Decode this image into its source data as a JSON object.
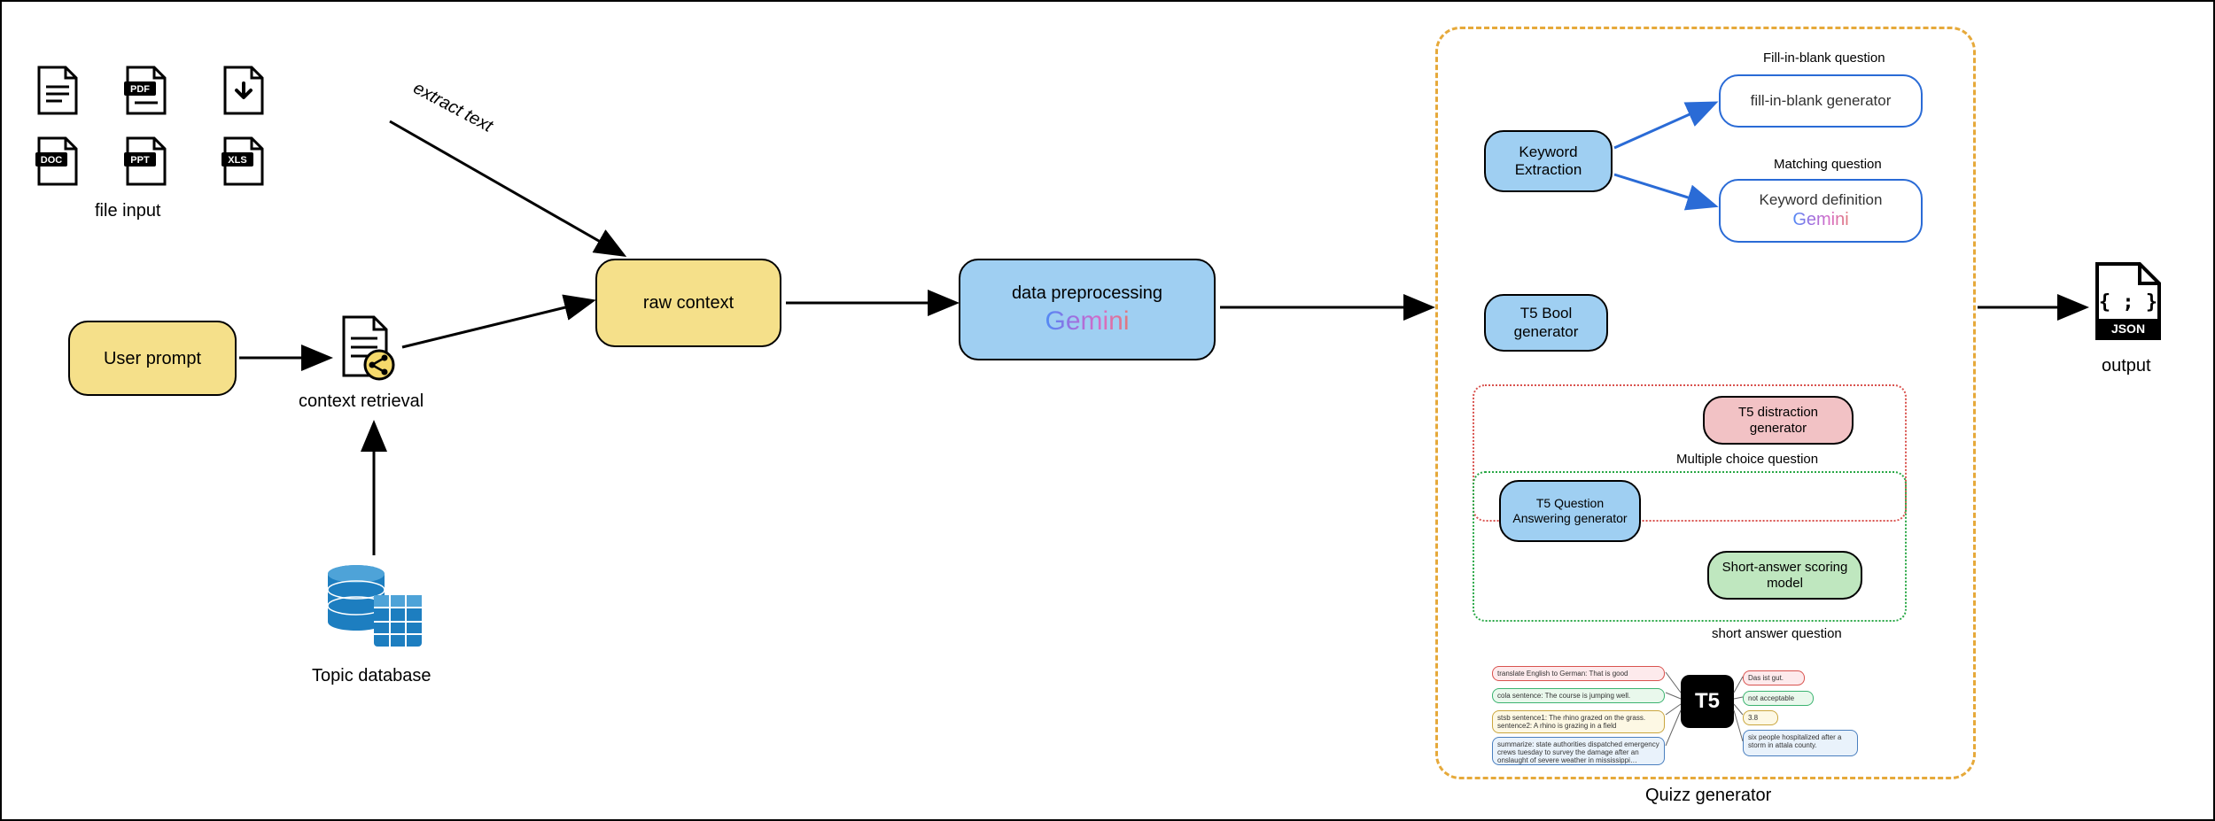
{
  "labels": {
    "file_input": "file input",
    "extract_text": "extract text",
    "context_retrieval": "context retrieval",
    "topic_database": "Topic database",
    "output": "output",
    "quizz_generator": "Quizz generator",
    "multiple_choice": "Multiple choice question",
    "short_answer_q": "short answer question",
    "fill_in_blank_q": "Fill-in-blank question",
    "matching_q": "Matching question"
  },
  "nodes": {
    "user_prompt": "User prompt",
    "raw_context": "raw context",
    "data_preprocessing": "data preprocessing",
    "gemini": "Gemini",
    "keyword_extraction": "Keyword Extraction",
    "fill_blank_gen": "fill-in-blank generator",
    "keyword_def": "Keyword definition",
    "t5_bool": "T5 Bool generator",
    "t5_distraction": "T5 distraction generator",
    "t5_qa_gen": "T5 Question Answering generator",
    "short_answer_model": "Short-answer scoring model",
    "t5_logo": "T5"
  },
  "file_icons": [
    "document",
    "pdf",
    "download",
    "doc",
    "ppt",
    "xls"
  ],
  "t5_chips": {
    "left": [
      "translate English to German: That is good",
      "cola sentence: The course is jumping well.",
      "stsb sentence1: The rhino grazed on the grass. sentence2: A rhino is grazing in a field",
      "summarize: state authorities dispatched emergency crews tuesday to survey the damage after an onslaught of severe weather in mississippi…"
    ],
    "right": [
      "Das ist gut.",
      "not acceptable",
      "3.8",
      "six people hospitalized after a storm in attala county."
    ]
  }
}
